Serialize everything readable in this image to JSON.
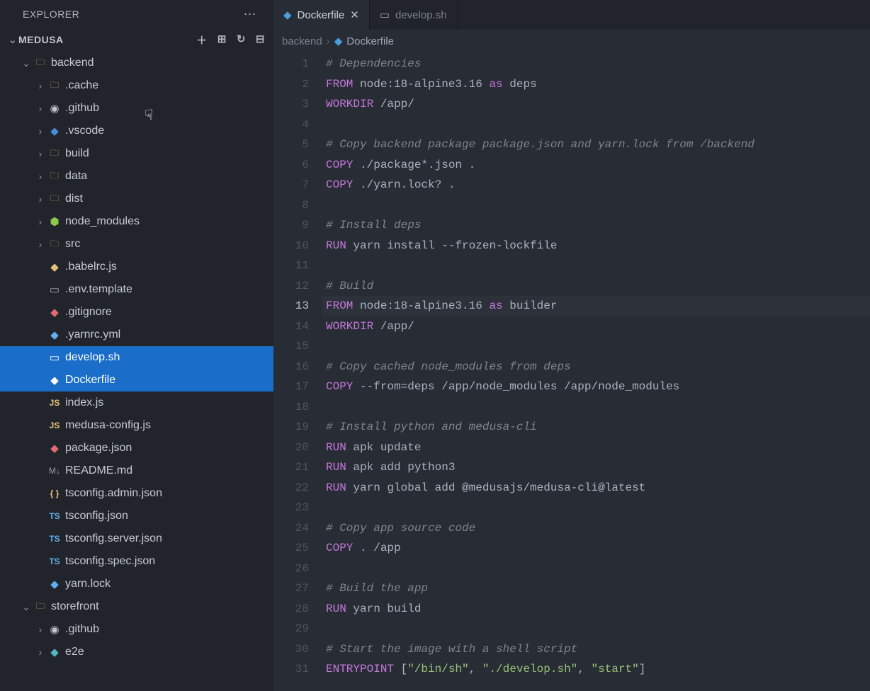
{
  "explorer": {
    "title": "EXPLORER",
    "project": "MEDUSA",
    "actions": {
      "new_file": "＋",
      "new_folder": "⊞",
      "refresh": "↻",
      "collapse": "⊟"
    }
  },
  "tree": [
    {
      "depth": 0,
      "exp": true,
      "kind": "folder",
      "iconCls": "ic-folder",
      "label": "backend",
      "sel": false,
      "name": "folder-backend"
    },
    {
      "depth": 1,
      "exp": false,
      "kind": "folder",
      "iconCls": "ic-folder",
      "label": ".cache",
      "sel": false,
      "name": "folder-cache"
    },
    {
      "depth": 1,
      "exp": false,
      "kind": "folder",
      "iconCls": "ic-github",
      "label": ".github",
      "sel": false,
      "name": "folder-github"
    },
    {
      "depth": 1,
      "exp": false,
      "kind": "folder",
      "iconCls": "ic-vscode",
      "label": ".vscode",
      "sel": false,
      "name": "folder-vscode"
    },
    {
      "depth": 1,
      "exp": false,
      "kind": "folder",
      "iconCls": "ic-folder",
      "label": "build",
      "sel": false,
      "name": "folder-build"
    },
    {
      "depth": 1,
      "exp": false,
      "kind": "folder",
      "iconCls": "ic-folder",
      "label": "data",
      "sel": false,
      "name": "folder-data"
    },
    {
      "depth": 1,
      "exp": false,
      "kind": "folder",
      "iconCls": "ic-folder",
      "label": "dist",
      "sel": false,
      "name": "folder-dist"
    },
    {
      "depth": 1,
      "exp": false,
      "kind": "folder",
      "iconCls": "ic-node",
      "label": "node_modules",
      "sel": false,
      "name": "folder-node-modules"
    },
    {
      "depth": 1,
      "exp": false,
      "kind": "folder",
      "iconCls": "ic-folder-green",
      "label": "src",
      "sel": false,
      "name": "folder-src"
    },
    {
      "depth": 1,
      "kind": "file",
      "iconCls": "ic-yellow",
      "label": ".babelrc.js",
      "sel": false,
      "name": "file-babelrc"
    },
    {
      "depth": 1,
      "kind": "file",
      "iconCls": "ic-sh",
      "label": ".env.template",
      "sel": false,
      "name": "file-env-template"
    },
    {
      "depth": 1,
      "kind": "file",
      "iconCls": "ic-red",
      "label": ".gitignore",
      "sel": false,
      "name": "file-gitignore"
    },
    {
      "depth": 1,
      "kind": "file",
      "iconCls": "ic-blue",
      "label": ".yarnrc.yml",
      "sel": false,
      "name": "file-yarnrc"
    },
    {
      "depth": 1,
      "kind": "file",
      "iconCls": "ic-sh",
      "label": "develop.sh",
      "sel": true,
      "name": "file-develop-sh"
    },
    {
      "depth": 1,
      "kind": "file",
      "iconCls": "ic-docker",
      "label": "Dockerfile",
      "sel": true,
      "name": "file-dockerfile"
    },
    {
      "depth": 1,
      "kind": "file",
      "iconCls": "ic-yellow",
      "label": "index.js",
      "sel": false,
      "name": "file-index-js",
      "iconText": "JS"
    },
    {
      "depth": 1,
      "kind": "file",
      "iconCls": "ic-yellow",
      "label": "medusa-config.js",
      "sel": false,
      "name": "file-medusa-config",
      "iconText": "JS"
    },
    {
      "depth": 1,
      "kind": "file",
      "iconCls": "ic-red",
      "label": "package.json",
      "sel": false,
      "name": "file-package-json"
    },
    {
      "depth": 1,
      "kind": "file",
      "iconCls": "ic-md",
      "label": "README.md",
      "sel": false,
      "name": "file-readme"
    },
    {
      "depth": 1,
      "kind": "file",
      "iconCls": "ic-json",
      "label": "tsconfig.admin.json",
      "sel": false,
      "name": "file-tsconfig-admin",
      "iconText": "{ }"
    },
    {
      "depth": 1,
      "kind": "file",
      "iconCls": "ic-ts",
      "label": "tsconfig.json",
      "sel": false,
      "name": "file-tsconfig",
      "iconText": "TS"
    },
    {
      "depth": 1,
      "kind": "file",
      "iconCls": "ic-ts",
      "label": "tsconfig.server.json",
      "sel": false,
      "name": "file-tsconfig-server",
      "iconText": "TS"
    },
    {
      "depth": 1,
      "kind": "file",
      "iconCls": "ic-ts",
      "label": "tsconfig.spec.json",
      "sel": false,
      "name": "file-tsconfig-spec",
      "iconText": "TS"
    },
    {
      "depth": 1,
      "kind": "file",
      "iconCls": "ic-blue",
      "label": "yarn.lock",
      "sel": false,
      "name": "file-yarn-lock"
    },
    {
      "depth": 0,
      "exp": true,
      "kind": "folder",
      "iconCls": "ic-folder",
      "label": "storefront",
      "sel": false,
      "name": "folder-storefront"
    },
    {
      "depth": 1,
      "exp": false,
      "kind": "folder",
      "iconCls": "ic-github",
      "label": ".github",
      "sel": false,
      "name": "folder-github-2"
    },
    {
      "depth": 1,
      "exp": false,
      "kind": "folder",
      "iconCls": "ic-teal",
      "label": "e2e",
      "sel": false,
      "name": "folder-e2e"
    }
  ],
  "tabs": [
    {
      "label": "Dockerfile",
      "iconCls": "ic-docker",
      "active": true,
      "close": true
    },
    {
      "label": "develop.sh",
      "iconCls": "ic-sh",
      "active": false,
      "close": false
    }
  ],
  "breadcrumb": {
    "parent": "backend",
    "file": "Dockerfile"
  },
  "currentLine": 13,
  "code": [
    [
      {
        "c": "tok-comment",
        "t": "# Dependencies"
      }
    ],
    [
      {
        "c": "tok-kw",
        "t": "FROM"
      },
      {
        "c": "",
        "t": " node:"
      },
      {
        "c": "",
        "t": "18"
      },
      {
        "c": "",
        "t": "-alpine3."
      },
      {
        "c": "",
        "t": "16"
      },
      {
        "c": "",
        "t": " "
      },
      {
        "c": "tok-kw",
        "t": "as"
      },
      {
        "c": "",
        "t": " deps"
      }
    ],
    [
      {
        "c": "tok-kw",
        "t": "WORKDIR"
      },
      {
        "c": "",
        "t": " /app/"
      }
    ],
    [],
    [
      {
        "c": "tok-comment",
        "t": "# Copy backend package package.json and yarn.lock from /backend"
      }
    ],
    [
      {
        "c": "tok-kw",
        "t": "COPY"
      },
      {
        "c": "",
        "t": " ./package*.json ."
      }
    ],
    [
      {
        "c": "tok-kw",
        "t": "COPY"
      },
      {
        "c": "",
        "t": " ./yarn.lock? ."
      }
    ],
    [],
    [
      {
        "c": "tok-comment",
        "t": "# Install deps"
      }
    ],
    [
      {
        "c": "tok-kw",
        "t": "RUN"
      },
      {
        "c": "",
        "t": " yarn install --frozen-lockfile"
      }
    ],
    [],
    [
      {
        "c": "tok-comment",
        "t": "# Build"
      }
    ],
    [
      {
        "c": "tok-kw",
        "t": "FROM"
      },
      {
        "c": "",
        "t": " node:"
      },
      {
        "c": "",
        "t": "18"
      },
      {
        "c": "",
        "t": "-alpine3."
      },
      {
        "c": "",
        "t": "16"
      },
      {
        "c": "",
        "t": " "
      },
      {
        "c": "tok-kw",
        "t": "as"
      },
      {
        "c": "",
        "t": " builder"
      }
    ],
    [
      {
        "c": "tok-kw",
        "t": "WORKDIR"
      },
      {
        "c": "",
        "t": " /app/"
      }
    ],
    [],
    [
      {
        "c": "tok-comment",
        "t": "# Copy cached node_modules from deps"
      }
    ],
    [
      {
        "c": "tok-kw",
        "t": "COPY"
      },
      {
        "c": "",
        "t": " --from=deps /app/node_modules /app/node_modules"
      }
    ],
    [],
    [
      {
        "c": "tok-comment",
        "t": "# Install python and medusa-cli"
      }
    ],
    [
      {
        "c": "tok-kw",
        "t": "RUN"
      },
      {
        "c": "",
        "t": " apk update"
      }
    ],
    [
      {
        "c": "tok-kw",
        "t": "RUN"
      },
      {
        "c": "",
        "t": " apk add python3"
      }
    ],
    [
      {
        "c": "tok-kw",
        "t": "RUN"
      },
      {
        "c": "",
        "t": " yarn global add @medusajs/medusa-cli@latest"
      }
    ],
    [],
    [
      {
        "c": "tok-comment",
        "t": "# Copy app source code"
      }
    ],
    [
      {
        "c": "tok-kw",
        "t": "COPY"
      },
      {
        "c": "",
        "t": " . /app"
      }
    ],
    [],
    [
      {
        "c": "tok-comment",
        "t": "# Build the app"
      }
    ],
    [
      {
        "c": "tok-kw",
        "t": "RUN"
      },
      {
        "c": "",
        "t": " yarn build"
      }
    ],
    [],
    [
      {
        "c": "tok-comment",
        "t": "# Start the image with a shell script"
      }
    ],
    [
      {
        "c": "tok-kw",
        "t": "ENTRYPOINT"
      },
      {
        "c": "",
        "t": " ["
      },
      {
        "c": "tok-str",
        "t": "\"/bin/sh\""
      },
      {
        "c": "",
        "t": ", "
      },
      {
        "c": "tok-str",
        "t": "\"./develop.sh\""
      },
      {
        "c": "",
        "t": ", "
      },
      {
        "c": "tok-str",
        "t": "\"start\""
      },
      {
        "c": "",
        "t": "]"
      }
    ]
  ]
}
